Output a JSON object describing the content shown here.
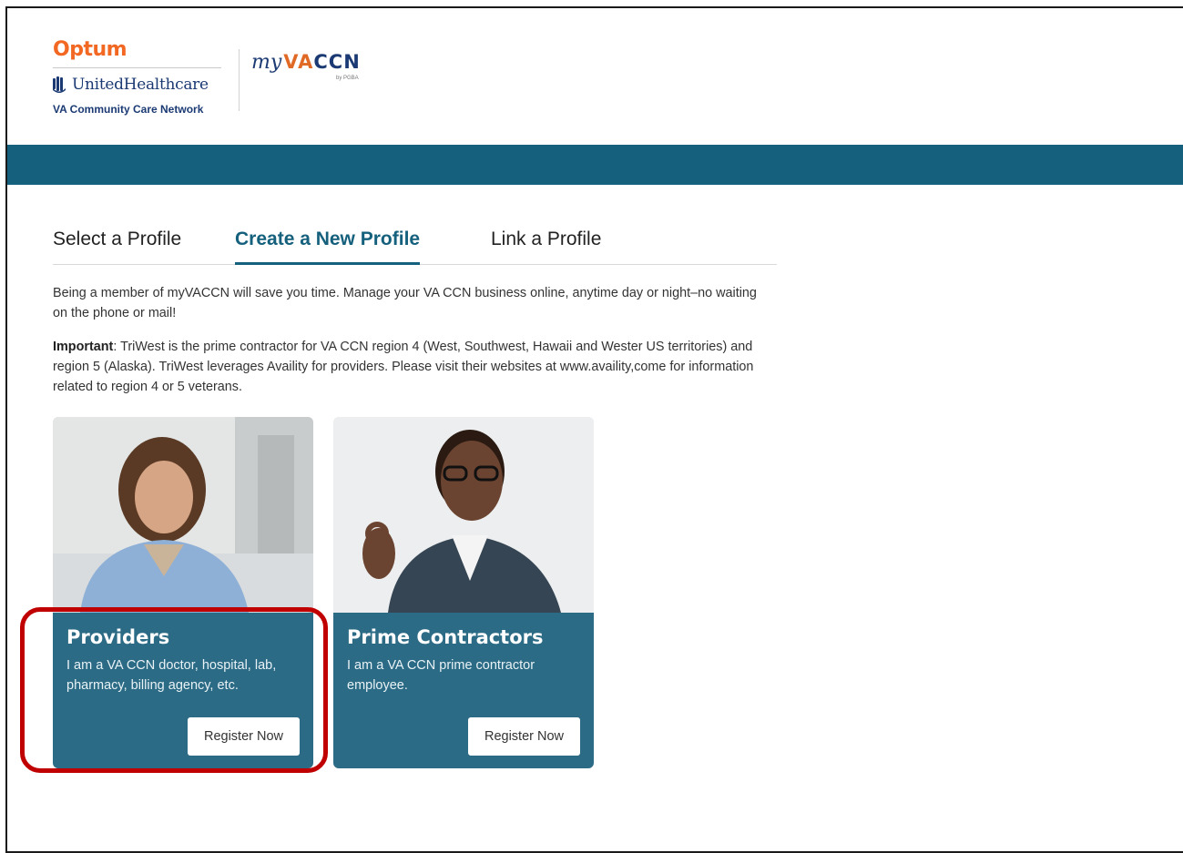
{
  "header": {
    "optum": "Optum",
    "uhc": "UnitedHealthcare",
    "network": "VA Community Care Network",
    "myvaccn_my": "my",
    "myvaccn_va": "VA",
    "myvaccn_ccn": "CCN",
    "by_pgba": "by PGBA"
  },
  "tabs": [
    {
      "label": "Select a Profile",
      "active": false
    },
    {
      "label": "Create a New Profile",
      "active": true
    },
    {
      "label": "Link a Profile",
      "active": false
    }
  ],
  "intro": "Being a member of myVACCN will save you time. Manage your VA CCN business online, anytime day or night–no waiting on the phone or mail!",
  "important": {
    "label": "Important",
    "text": ": TriWest is the prime contractor for VA CCN region 4 (West, Southwest, Hawaii and Wester US territories) and region 5 (Alaska). TriWest leverages Availity for providers. Please visit their websites at www.availity,come for information related to region 4 or 5 veterans."
  },
  "cards": [
    {
      "title": "Providers",
      "description": "I am a VA CCN doctor, hospital, lab, pharmacy, billing agency, etc.",
      "button": "Register Now"
    },
    {
      "title": "Prime Contractors",
      "description": "I am a VA CCN prime contractor employee.",
      "button": "Register Now"
    }
  ],
  "colors": {
    "banner": "#15607c",
    "accent": "#15607c",
    "optum": "#f26722",
    "highlight": "#c00000"
  }
}
